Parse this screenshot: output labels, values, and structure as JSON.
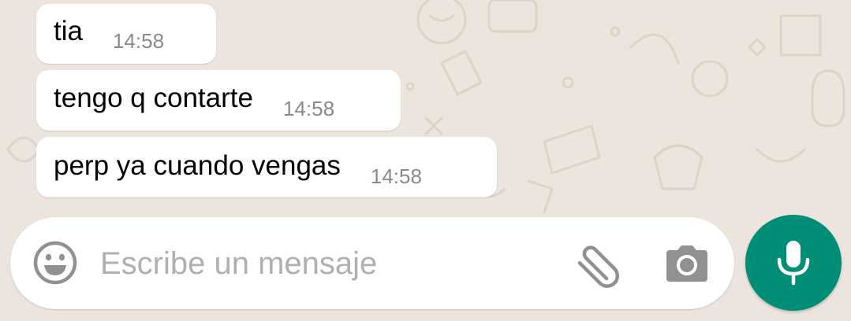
{
  "messages": [
    {
      "text": "tia",
      "time": "14:58"
    },
    {
      "text": "tengo q contarte",
      "time": "14:58"
    },
    {
      "text": "perp ya cuando vengas",
      "time": "14:58"
    }
  ],
  "composer": {
    "placeholder": "Escribe un mensaje",
    "value": "",
    "emoji_icon": "emoji-smiley-icon",
    "attach_icon": "paperclip-icon",
    "camera_icon": "camera-icon"
  },
  "mic_button": {
    "icon": "microphone-icon"
  },
  "colors": {
    "background": "#ece5dd",
    "bubble": "#ffffff",
    "accent": "#008f76",
    "timestamp": "#8a8a8a",
    "placeholder": "#b0b0b0"
  }
}
